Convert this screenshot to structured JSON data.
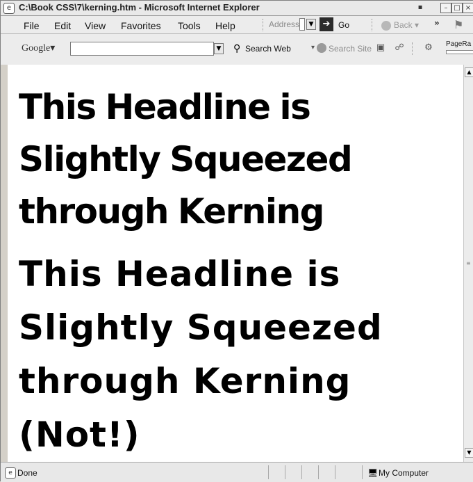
{
  "window": {
    "title": "C:\\Book CSS\\7\\kerning.htm - Microsoft Internet Explorer"
  },
  "menu": {
    "items": [
      {
        "label": "File"
      },
      {
        "label": "Edit"
      },
      {
        "label": "View"
      },
      {
        "label": "Favorites"
      },
      {
        "label": "Tools"
      },
      {
        "label": "Help"
      }
    ]
  },
  "toolbar": {
    "address_label": "Address",
    "go_label": "Go",
    "back_label": "Back"
  },
  "google": {
    "logo": "Google",
    "search_web": "Search Web",
    "search_site": "Search Site",
    "pagerank": "PageRa"
  },
  "content": {
    "kerned_lines": [
      "This Headline is",
      "Slightly Squeezed",
      "through Kerning"
    ],
    "normal_lines": [
      "This Headline is",
      "Slightly Squeezed",
      "through Kerning",
      "(Not!)"
    ]
  },
  "status": {
    "text": "Done",
    "zone": "My Computer"
  }
}
